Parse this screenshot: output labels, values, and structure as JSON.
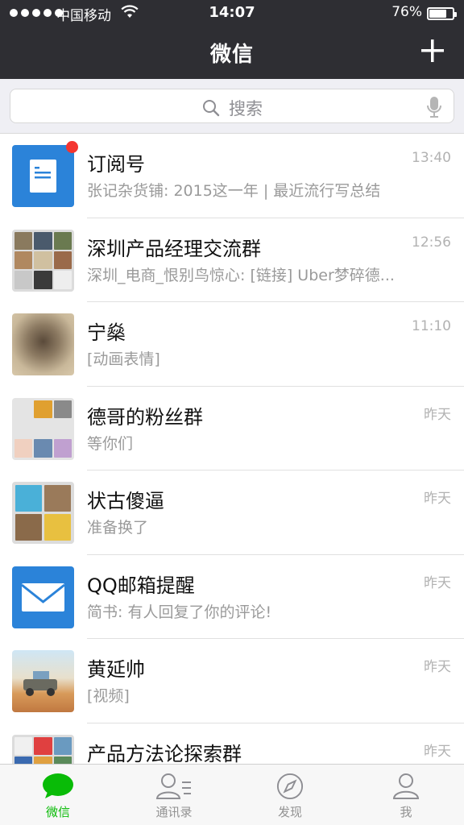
{
  "status_bar": {
    "carrier": "中国移动",
    "time": "14:07",
    "battery_text": "76%",
    "battery_level": 0.76
  },
  "header": {
    "title": "微信",
    "add_icon": "plus-icon"
  },
  "search": {
    "placeholder": "搜索",
    "search_icon": "search-icon",
    "mic_icon": "microphone-icon"
  },
  "chats": [
    {
      "name": "订阅号",
      "preview": "张记杂货铺: 2015这一年 | 最近流行写总结",
      "time": "13:40",
      "unread_dot": true,
      "avatar": "subscription-icon"
    },
    {
      "name": "深圳产品经理交流群",
      "preview": "深圳_电商_恨别鸟惊心: [链接] Uber梦碎德...",
      "time": "12:56",
      "unread_dot": false,
      "avatar": "group-avatar"
    },
    {
      "name": "宁燊",
      "preview": "[动画表情]",
      "time": "11:10",
      "unread_dot": false,
      "avatar": "user-avatar"
    },
    {
      "name": "德哥的粉丝群",
      "preview": "等你们",
      "time": "昨天",
      "unread_dot": false,
      "avatar": "group-avatar"
    },
    {
      "name": "状古傻逼",
      "preview": "准备换了",
      "time": "昨天",
      "unread_dot": false,
      "avatar": "group-avatar"
    },
    {
      "name": "QQ邮箱提醒",
      "preview": "简书: 有人回复了你的评论!",
      "time": "昨天",
      "unread_dot": false,
      "avatar": "mail-icon"
    },
    {
      "name": "黄延帅",
      "preview": "[视频]",
      "time": "昨天",
      "unread_dot": false,
      "avatar": "user-avatar"
    },
    {
      "name": "产品方法论探索群",
      "preview": "",
      "time": "昨天",
      "unread_dot": false,
      "avatar": "group-avatar"
    }
  ],
  "tabs": [
    {
      "label": "微信",
      "icon": "chat-bubble-icon",
      "active": true
    },
    {
      "label": "通讯录",
      "icon": "contacts-icon",
      "active": false
    },
    {
      "label": "发现",
      "icon": "compass-icon",
      "active": false
    },
    {
      "label": "我",
      "icon": "person-icon",
      "active": false
    }
  ],
  "colors": {
    "header_bg": "#2e2e33",
    "active_green": "#09bb07",
    "unread_red": "#f43530",
    "subscription_blue": "#2b83d9"
  }
}
